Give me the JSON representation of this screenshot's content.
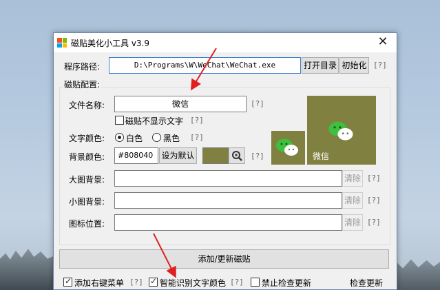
{
  "window": {
    "title": "磁贴美化小工具 v3.9",
    "close_glyph": "✕"
  },
  "path_row": {
    "label": "程序路径:",
    "value": "D:\\Programs\\W\\WeChat\\WeChat.exe",
    "open_dir_label": "打开目录",
    "init_label": "初始化",
    "help": "[?]"
  },
  "config": {
    "group_title": "磁贴配置:",
    "file_name_label": "文件名称:",
    "file_name_value": "微信",
    "file_name_help": "[?]",
    "hide_text_label": "磁贴不显示文字",
    "hide_text_checked": false,
    "hide_text_help": "[?]",
    "text_color_label": "文字颜色:",
    "white_label": "白色",
    "black_label": "黑色",
    "text_color_selected": "白色",
    "text_color_help": "[?]",
    "bg_color_label": "背景颜色:",
    "bg_color_value": "#808040",
    "set_default_label": "设为默认",
    "bg_color_help": "[?]",
    "swatch_color": "#808040",
    "large_bg_label": "大图背景:",
    "large_bg_clear": "清除",
    "large_bg_help": "[?]",
    "small_bg_label": "小图背景:",
    "small_bg_clear": "清除",
    "small_bg_help": "[?]",
    "icon_pos_label": "图标位置:",
    "icon_pos_clear": "清除",
    "icon_pos_help": "[?]"
  },
  "preview": {
    "large_tile_label": "微信",
    "tile_color": "#808040"
  },
  "add_update_label": "添加/更新磁贴",
  "status": {
    "context_menu_label": "添加右键菜单",
    "context_menu_checked": true,
    "context_menu_help": "[?]",
    "smart_color_label": "智能识别文字颜色",
    "smart_color_checked": true,
    "smart_color_help": "[?]",
    "disable_update_label": "禁止检查更新",
    "disable_update_checked": false,
    "check_update_label": "检查更新"
  }
}
